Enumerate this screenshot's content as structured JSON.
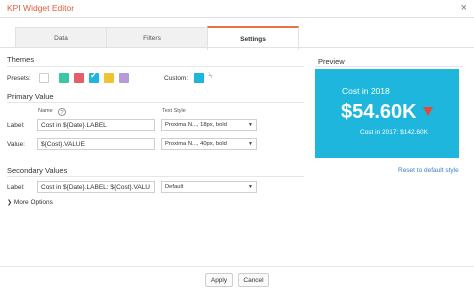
{
  "window": {
    "title": "KPI Widget Editor",
    "close": "×"
  },
  "tabs": [
    {
      "label": "Data"
    },
    {
      "label": "Filters"
    },
    {
      "label": "Settings",
      "active": true
    }
  ],
  "themes": {
    "heading": "Themes",
    "presets_label": "Presets:",
    "presets": [
      "#ffffff",
      "#3ac7a4",
      "#e45e6b",
      "#1eb6dc",
      "#f1c232",
      "#b99ad8"
    ],
    "selected_preset": "#1eb6dc",
    "custom_label": "Custom:",
    "custom_color": "#1eb6dc"
  },
  "primary": {
    "heading": "Primary Value",
    "name_col": "Name",
    "style_col": "Text Style",
    "label_row": {
      "label": "Label:",
      "value": "Cost in ${Date}.LABEL",
      "style": "Proxima N..., 18px, bold"
    },
    "value_row": {
      "label": "Value:",
      "value": "${Cost}.VALUE",
      "style": "Proxima N..., 40px, bold"
    }
  },
  "preview": {
    "heading": "Preview",
    "title": "Cost in 2018",
    "value": "$54.60K",
    "sub": "Cost in 2017: $142.60K",
    "bg": "#1eb6dc",
    "trend": "down",
    "reset": "Reset to default style"
  },
  "secondary": {
    "heading": "Secondary Values",
    "label_row": {
      "label": "Label:",
      "value": "Cost in ${Date}.LABEL: ${Cost}.VALU",
      "style": "Default"
    }
  },
  "more_options": "More Options",
  "buttons": {
    "apply": "Apply",
    "cancel": "Cancel"
  }
}
